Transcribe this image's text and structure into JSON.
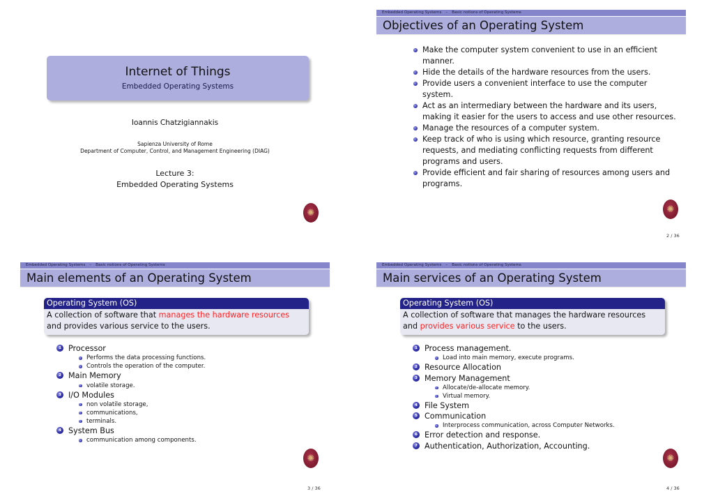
{
  "colors": {
    "header_bar": "#8585cc",
    "frame_title_bg": "#adadde",
    "block_title_bg": "#222288",
    "block_body_bg": "#e8e8f2",
    "alert_text": "#ff2020",
    "logo": "#7d1a2e"
  },
  "breadcrumb": {
    "section": "Embedded Operating Systems",
    "separator": "–",
    "subsection": "Basic notions of Operating Systems"
  },
  "slides": [
    {
      "title": "Internet of Things",
      "subtitle": "Embedded Operating Systems",
      "author": "Ioannis Chatzigiannakis",
      "institution_line1": "Sapienza University of Rome",
      "institution_line2": "Department of Computer, Control, and Management Engineering (DIAG)",
      "lecture_line1": "Lecture 3:",
      "lecture_line2": "Embedded Operating Systems",
      "logo_icon": "university-seal-icon"
    },
    {
      "frame_title": "Objectives of an Operating System",
      "bullets": [
        "Make the computer system convenient to use in an efficient manner.",
        "Hide the details of the hardware resources from the users.",
        "Provide users a convenient interface to use the computer system.",
        "Act as an intermediary between the hardware and its users, making it easier for the users to access and use other resources.",
        "Manage the resources of a computer system.",
        "Keep track of who is using which resource, granting resource requests, and mediating conflicting requests from different programs and users.",
        "Provide efficient and fair sharing of resources among users and programs."
      ],
      "page": "2 / 36"
    },
    {
      "frame_title": "Main elements of an Operating System",
      "block_title": "Operating System (OS)",
      "block_text": {
        "before": "A collection of software that ",
        "highlight": "manages the hardware resources",
        "after": " and provides various service to the users."
      },
      "items": [
        {
          "num": "1",
          "label": "Processor",
          "sub": [
            "Performs the data processing functions.",
            "Controls the operation of the computer."
          ]
        },
        {
          "num": "2",
          "label": "Main Memory",
          "sub": [
            "volatile storage."
          ]
        },
        {
          "num": "3",
          "label": "I/O Modules",
          "sub": [
            "non volatile storage,",
            "communications,",
            "terminals."
          ]
        },
        {
          "num": "4",
          "label": "System Bus",
          "sub": [
            "communication among components."
          ]
        }
      ],
      "page": "3 / 36"
    },
    {
      "frame_title": "Main services of an Operating System",
      "block_title": "Operating System (OS)",
      "block_text": {
        "before": "A collection of software that manages the hardware resources and ",
        "highlight": "provides various service",
        "after": " to the users."
      },
      "items": [
        {
          "num": "1",
          "label": "Process management.",
          "sub": [
            "Load into main memory, execute programs."
          ]
        },
        {
          "num": "2",
          "label": "Resource Allocation",
          "sub": []
        },
        {
          "num": "3",
          "label": "Memory Management",
          "sub": [
            "Allocate/de-allocate memory.",
            "Virtual memory."
          ]
        },
        {
          "num": "4",
          "label": "File System",
          "sub": []
        },
        {
          "num": "5",
          "label": "Communication",
          "sub": [
            "Interprocess communication, across Computer Networks."
          ]
        },
        {
          "num": "6",
          "label": "Error detection and response.",
          "sub": []
        },
        {
          "num": "7",
          "label": "Authentication, Authorization, Accounting.",
          "sub": []
        }
      ],
      "page": "4 / 36"
    }
  ]
}
